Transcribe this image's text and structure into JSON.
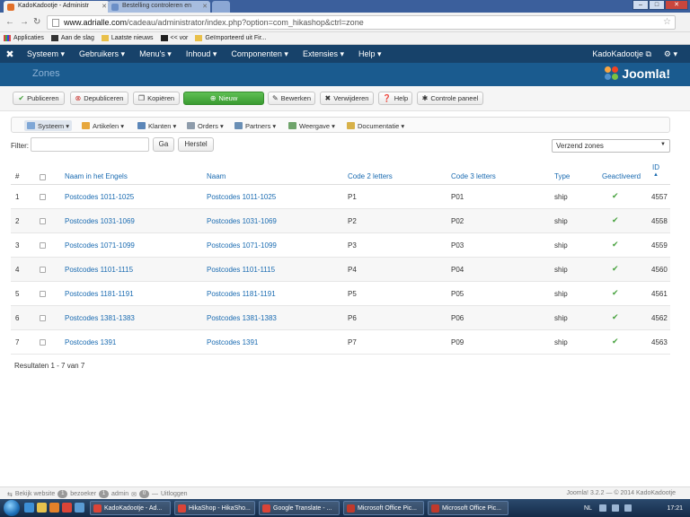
{
  "browser": {
    "tabs": [
      {
        "label": "KadoKadootje - Administr",
        "active": true
      },
      {
        "label": "Bestelling controleren en",
        "active": false
      }
    ],
    "url_host": "www.adrialle.com",
    "url_path": "/cadeau/administrator/index.php?option=com_hikashop&ctrl=zone",
    "bookmarks": [
      "Applicaties",
      "Aan de slag",
      "Laatste nieuws",
      "<< vor",
      "Geïmporteerd uit Fir..."
    ]
  },
  "topnav": {
    "items": [
      "Systeem ▾",
      "Gebruikers ▾",
      "Menu's ▾",
      "Inhoud ▾",
      "Componenten ▾",
      "Extensies ▾",
      "Help ▾"
    ],
    "user": "KadoKadootje ⧉",
    "gear": "⚙ ▾"
  },
  "header": {
    "title": "Zones",
    "brand": "Joomla!"
  },
  "toolbar": {
    "publish": "Publiceren",
    "unpublish": "Depubliceren",
    "copy": "Kopiëren",
    "new": "Nieuw",
    "edit": "Bewerken",
    "delete": "Verwijderen",
    "help": "Help",
    "control_panel": "Controle paneel"
  },
  "submenu": [
    "Systeem ▾",
    "Artikelen ▾",
    "Klanten ▾",
    "Orders ▾",
    "Partners ▾",
    "Weergave ▾",
    "Documentatie ▾"
  ],
  "filter": {
    "label": "Filter:",
    "value": "",
    "go": "Ga",
    "reset": "Herstel",
    "select_value": "Verzend zones"
  },
  "table": {
    "headers": {
      "num": "#",
      "name_en": "Naam in het Engels",
      "name": "Naam",
      "code2": "Code 2 letters",
      "code3": "Code 3 letters",
      "type": "Type",
      "active": "Geactiveerd",
      "id_line1": "ID",
      "id_line2": "▲"
    },
    "rows": [
      {
        "num": "1",
        "name_en": "Postcodes 1011-1025",
        "name": "Postcodes 1011-1025",
        "code2": "P1",
        "code3": "P01",
        "type": "ship",
        "active": "✔",
        "id": "4557"
      },
      {
        "num": "2",
        "name_en": "Postcodes 1031-1069",
        "name": "Postcodes 1031-1069",
        "code2": "P2",
        "code3": "P02",
        "type": "ship",
        "active": "✔",
        "id": "4558"
      },
      {
        "num": "3",
        "name_en": "Postcodes 1071-1099",
        "name": "Postcodes 1071-1099",
        "code2": "P3",
        "code3": "P03",
        "type": "ship",
        "active": "✔",
        "id": "4559"
      },
      {
        "num": "4",
        "name_en": "Postcodes 1101-1115",
        "name": "Postcodes 1101-1115",
        "code2": "P4",
        "code3": "P04",
        "type": "ship",
        "active": "✔",
        "id": "4560"
      },
      {
        "num": "5",
        "name_en": "Postcodes 1181-1191",
        "name": "Postcodes 1181-1191",
        "code2": "P5",
        "code3": "P05",
        "type": "ship",
        "active": "✔",
        "id": "4561"
      },
      {
        "num": "6",
        "name_en": "Postcodes 1381-1383",
        "name": "Postcodes 1381-1383",
        "code2": "P6",
        "code3": "P06",
        "type": "ship",
        "active": "✔",
        "id": "4562"
      },
      {
        "num": "7",
        "name_en": "Postcodes 1391",
        "name": "Postcodes 1391",
        "code2": "P7",
        "code3": "P09",
        "type": "ship",
        "active": "✔",
        "id": "4563"
      }
    ]
  },
  "results": "Resultaten 1 - 7 van 7",
  "footer": {
    "view_site": "Bekijk website",
    "visitors_count": "1",
    "visitors": "bezoeker",
    "admins_count": "1",
    "admins": "admin",
    "messages_count": "0",
    "logout": "Uitloggen",
    "version": "Joomla! 3.2.2 — © 2014 KadoKadootje"
  },
  "taskbar": {
    "tasks": [
      "KadoKadootje - Ad...",
      "HikaShop - HikaSho...",
      "Google Translate - ...",
      "Microsoft Office Pic...",
      "Microsoft Office Pic..."
    ],
    "lang": "NL",
    "time": "17:21"
  },
  "colors": {
    "navbar": "#17426a",
    "header": "#1a5b8f",
    "link": "#1a6bb1",
    "new_button": "#46a83c",
    "check": "#48a23f"
  }
}
